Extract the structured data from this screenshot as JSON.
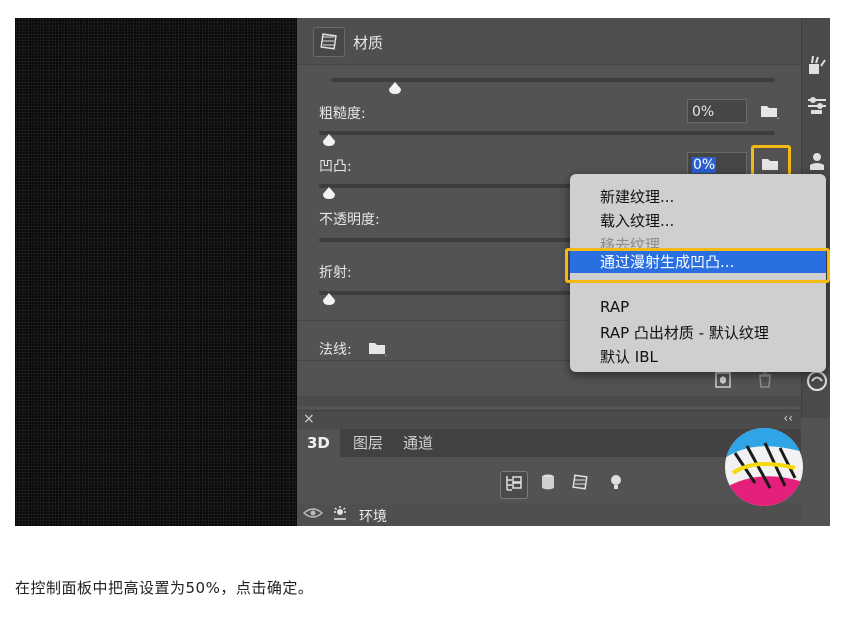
{
  "material_panel": {
    "title": "材质",
    "roughness_label": "粗糙度:",
    "roughness_value": "0%",
    "bump_label": "凹凸:",
    "bump_value": "0%",
    "opacity_label": "不透明度:",
    "refraction_label": "折射:",
    "normal_label": "法线:"
  },
  "context_menu": {
    "items": [
      "新建纹理...",
      "载入纹理...",
      "移去纹理",
      "通过漫射生成凹凸...",
      "RAP",
      "RAP 凸出材质 - 默认纹理",
      "默认 IBL"
    ],
    "disabled_item": "移去纹理",
    "active_item": "通过漫射生成凹凸..."
  },
  "bottom_panel": {
    "close_glyph": "×",
    "collapse_glyph": "‹‹",
    "tabs": [
      "3D",
      "图层",
      "通道"
    ],
    "active_tab": "3D",
    "scene_item": "环境"
  },
  "caption": "在控制面板中把高设置为50%，点击确定。",
  "colors": {
    "highlight_border": "#f5b913",
    "menu_active": "#2a6fe0",
    "panel_bg": "#535353"
  },
  "icons": [
    "material-icon",
    "folder-icon",
    "brush-tool-icon",
    "adjust-icon",
    "person-stamp-icon",
    "filter-icon",
    "cylinder-icon",
    "material-sphere-icon",
    "light-bulb-icon",
    "eye-icon",
    "environment-icon",
    "new-item-icon",
    "trash-icon",
    "render-icon"
  ]
}
